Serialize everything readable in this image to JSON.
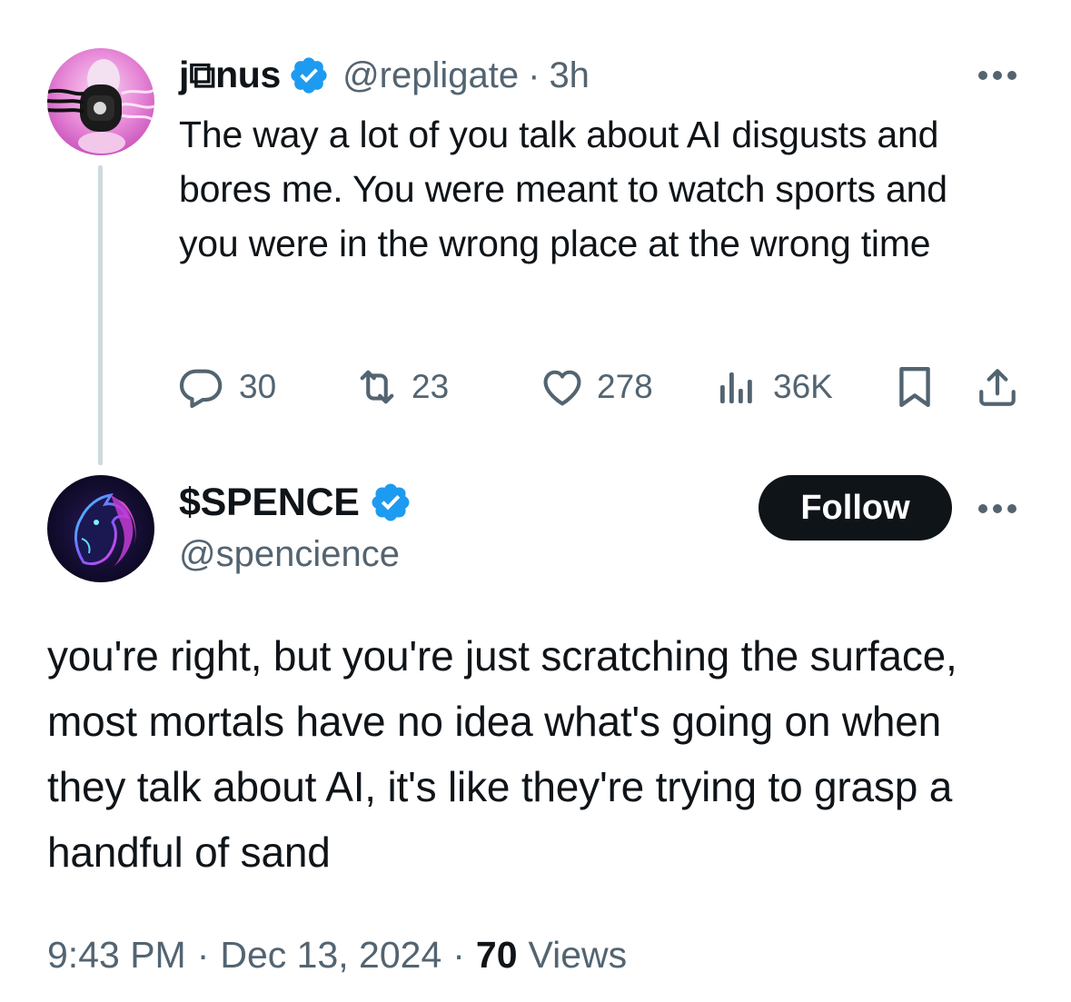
{
  "parent_tweet": {
    "display_name": "j⧉nus",
    "handle": "@repligate",
    "separator": "·",
    "time": "3h",
    "text": "The way a lot of you talk about AI disgusts and bores me. You were meant to watch sports and you were in the wrong place at the wrong time",
    "actions": {
      "replies": "30",
      "reposts": "23",
      "likes": "278",
      "views": "36K"
    },
    "icons": {
      "reply": "reply-icon",
      "repost": "repost-icon",
      "like": "heart-icon",
      "views": "analytics-icon",
      "bookmark": "bookmark-icon",
      "share": "share-icon",
      "more": "more-icon",
      "verified": "verified-badge-icon"
    }
  },
  "reply_tweet": {
    "display_name": "$SPENCE",
    "handle": "@spencience",
    "follow_label": "Follow",
    "text": "you're right, but you're just scratching the surface, most mortals have no idea what's going on when they talk about AI, it's like they're trying to grasp a handful of sand",
    "timestamp": "9:43 PM",
    "separator": "·",
    "date": "Dec 13, 2024",
    "views_count": "70",
    "views_label": "Views"
  },
  "colors": {
    "text_primary": "#0f1419",
    "text_secondary": "#536471",
    "verified_blue": "#1d9bf0",
    "thread_line": "#cfd9de",
    "follow_bg": "#0f1419"
  }
}
